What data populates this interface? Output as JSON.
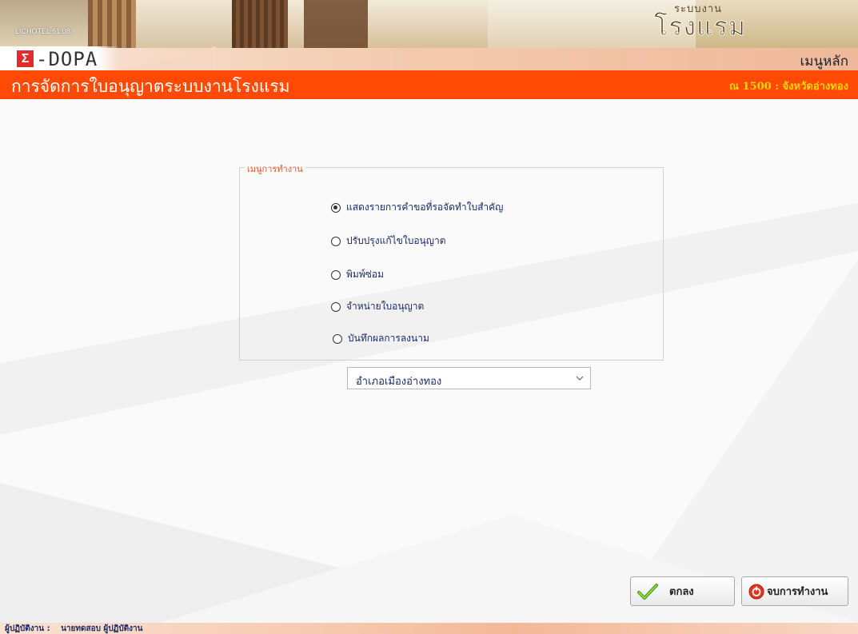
{
  "header": {
    "app_code": "LICHOTEL 61.08",
    "logo_mark": "Σ",
    "logo_text": "-DOPA",
    "system_small": "ระบบงาน",
    "system_big": "โรงแรม",
    "main_menu": "เมนูหลัก"
  },
  "title_bar": {
    "title": "การจัดการใบอนุญาตระบบงานโรงแรม",
    "location": "ณ 1500 : จังหวัดอ่างทอง"
  },
  "menu": {
    "legend": "เมนูการทำงาน",
    "options": [
      {
        "label": "แสดงรายการคำขอที่รอจัดทำใบสำคัญ",
        "checked": true
      },
      {
        "label": "ปรับปรุงแก้ไขใบอนุญาต",
        "checked": false
      },
      {
        "label": "พิมพ์ซ่อม",
        "checked": false
      },
      {
        "label": "จำหน่ายใบอนุญาต",
        "checked": false
      },
      {
        "label": "บันทึกผลการลงนาม",
        "checked": false
      }
    ]
  },
  "district_select": {
    "value": "อำเภอเมืองอ่างทอง"
  },
  "buttons": {
    "ok_label": "ตกลง",
    "exit_label": "จบการทำงาน"
  },
  "status_bar": {
    "operator_label": "ผู้ปฏิบัติงาน :",
    "operator_name": "นายทดสอบ ผู้ปฏิบัติงาน"
  },
  "colors": {
    "title_bar": "#ff4a05",
    "location_text": "#ffd400",
    "legend_text": "#e3562a",
    "option_text": "#1b2a66",
    "logo_mark": "#e22b2b"
  },
  "icons": {
    "ok": "checkmark-icon",
    "exit": "power-stop-icon",
    "select": "chevron-down-icon"
  }
}
